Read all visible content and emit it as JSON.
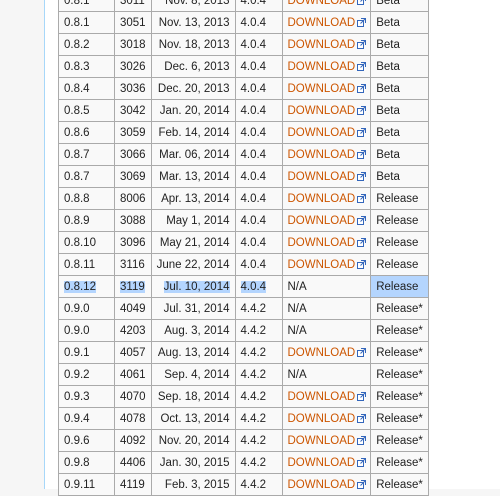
{
  "rows": [
    {
      "version": "0.8.1",
      "build": "3011",
      "date": "Nov. 8, 2013",
      "android": "4.0.4",
      "download": "DOWNLOAD",
      "channel": "Beta"
    },
    {
      "version": "0.8.1",
      "build": "3051",
      "date": "Nov. 13, 2013",
      "android": "4.0.4",
      "download": "DOWNLOAD",
      "channel": "Beta"
    },
    {
      "version": "0.8.2",
      "build": "3018",
      "date": "Nov. 18, 2013",
      "android": "4.0.4",
      "download": "DOWNLOAD",
      "channel": "Beta"
    },
    {
      "version": "0.8.3",
      "build": "3026",
      "date": "Dec. 6, 2013",
      "android": "4.0.4",
      "download": "DOWNLOAD",
      "channel": "Beta"
    },
    {
      "version": "0.8.4",
      "build": "3036",
      "date": "Dec. 20, 2013",
      "android": "4.0.4",
      "download": "DOWNLOAD",
      "channel": "Beta"
    },
    {
      "version": "0.8.5",
      "build": "3042",
      "date": "Jan. 20, 2014",
      "android": "4.0.4",
      "download": "DOWNLOAD",
      "channel": "Beta"
    },
    {
      "version": "0.8.6",
      "build": "3059",
      "date": "Feb. 14, 2014",
      "android": "4.0.4",
      "download": "DOWNLOAD",
      "channel": "Beta"
    },
    {
      "version": "0.8.7",
      "build": "3066",
      "date": "Mar. 06, 2014",
      "android": "4.0.4",
      "download": "DOWNLOAD",
      "channel": "Beta"
    },
    {
      "version": "0.8.7",
      "build": "3069",
      "date": "Mar. 13, 2014",
      "android": "4.0.4",
      "download": "DOWNLOAD",
      "channel": "Beta"
    },
    {
      "version": "0.8.8",
      "build": "8006",
      "date": "Apr. 13, 2014",
      "android": "4.0.4",
      "download": "DOWNLOAD",
      "channel": "Release"
    },
    {
      "version": "0.8.9",
      "build": "3088",
      "date": "May 1, 2014",
      "android": "4.0.4",
      "download": "DOWNLOAD",
      "channel": "Release"
    },
    {
      "version": "0.8.10",
      "build": "3096",
      "date": "May 21, 2014",
      "android": "4.0.4",
      "download": "DOWNLOAD",
      "channel": "Release"
    },
    {
      "version": "0.8.11",
      "build": "3116",
      "date": "June 22, 2014",
      "android": "4.0.4",
      "download": "DOWNLOAD",
      "channel": "Release"
    },
    {
      "version": "0.8.12",
      "build": "3119",
      "date": "Jul. 10, 2014",
      "android": "4.0.4",
      "download": "N/A",
      "channel": "Release",
      "highlighted": true
    },
    {
      "version": "0.9.0",
      "build": "4049",
      "date": "Jul. 31, 2014",
      "android": "4.4.2",
      "download": "N/A",
      "channel": "Release*"
    },
    {
      "version": "0.9.0",
      "build": "4203",
      "date": "Aug. 3, 2014",
      "android": "4.4.2",
      "download": "N/A",
      "channel": "Release*"
    },
    {
      "version": "0.9.1",
      "build": "4057",
      "date": "Aug. 13, 2014",
      "android": "4.4.2",
      "download": "DOWNLOAD",
      "channel": "Release*"
    },
    {
      "version": "0.9.2",
      "build": "4061",
      "date": "Sep. 4, 2014",
      "android": "4.4.2",
      "download": "N/A",
      "channel": "Release*"
    },
    {
      "version": "0.9.3",
      "build": "4070",
      "date": "Sep. 18, 2014",
      "android": "4.4.2",
      "download": "DOWNLOAD",
      "channel": "Release*"
    },
    {
      "version": "0.9.4",
      "build": "4078",
      "date": "Oct. 13, 2014",
      "android": "4.4.2",
      "download": "DOWNLOAD",
      "channel": "Release*"
    },
    {
      "version": "0.9.6",
      "build": "4092",
      "date": "Nov. 20, 2014",
      "android": "4.4.2",
      "download": "DOWNLOAD",
      "channel": "Release*"
    },
    {
      "version": "0.9.8",
      "build": "4406",
      "date": "Jan. 30, 2015",
      "android": "4.4.2",
      "download": "DOWNLOAD",
      "channel": "Release*"
    },
    {
      "version": "0.9.11",
      "build": "4119",
      "date": "Feb. 3, 2015",
      "android": "4.4.2",
      "download": "DOWNLOAD",
      "channel": "Release*"
    }
  ],
  "colors": {
    "link": "#cc5500",
    "highlight": "#b4d5fe",
    "border": "#aaaaaa",
    "cell_bg": "#f9f9f9"
  }
}
